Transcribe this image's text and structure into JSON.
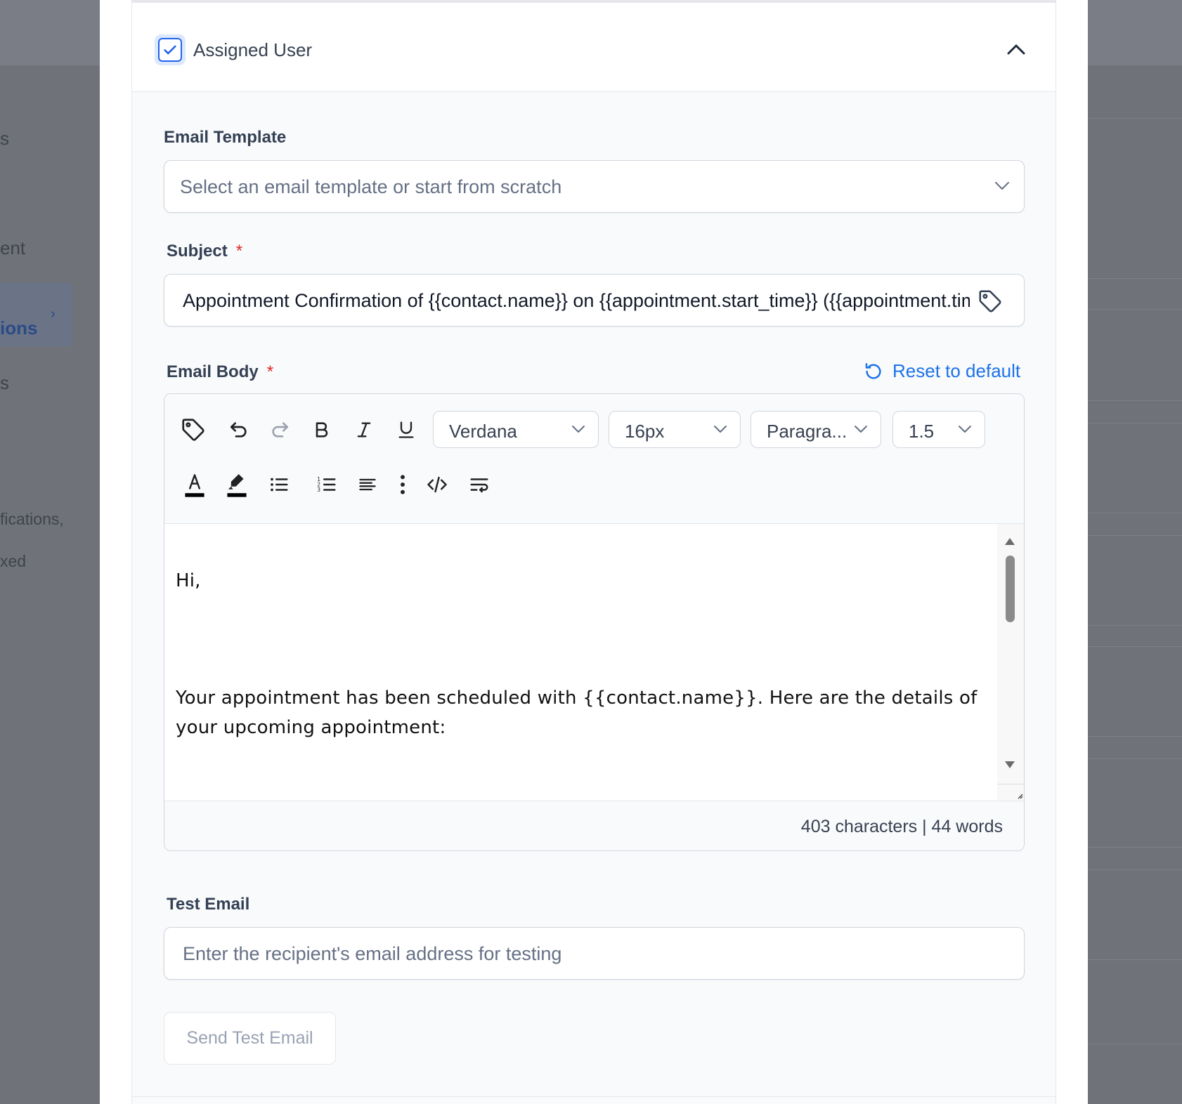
{
  "background": {
    "sidebar_fragments": [
      "s",
      "ent",
      "ions",
      "s",
      "fications,",
      "xed"
    ]
  },
  "section": {
    "title": "Assigned User",
    "checked": true
  },
  "email_template": {
    "label": "Email Template",
    "placeholder": "Select an email template or start from scratch"
  },
  "subject": {
    "label": "Subject",
    "required_mark": "*",
    "value": "Appointment Confirmation of {{contact.name}} on {{appointment.start_time}} ({{appointment.timezone}})"
  },
  "email_body": {
    "label": "Email Body",
    "required_mark": "*",
    "reset_label": "Reset to default",
    "toolbar": {
      "font_family": "Verdana",
      "font_size": "16px",
      "block_format": "Paragra...",
      "line_height": "1.5"
    },
    "content": {
      "greeting": "Hi,",
      "paragraph": "Your appointment has been scheduled with {{contact.name}}. Here are the details of your upcoming appointment:"
    },
    "counts": "403 characters | 44 words"
  },
  "test_email": {
    "label": "Test Email",
    "placeholder": "Enter the recipient's email address for testing",
    "send_label": "Send Test Email"
  },
  "colors": {
    "accent": "#2563eb",
    "link": "#1d73e8",
    "required": "#dc2626"
  }
}
